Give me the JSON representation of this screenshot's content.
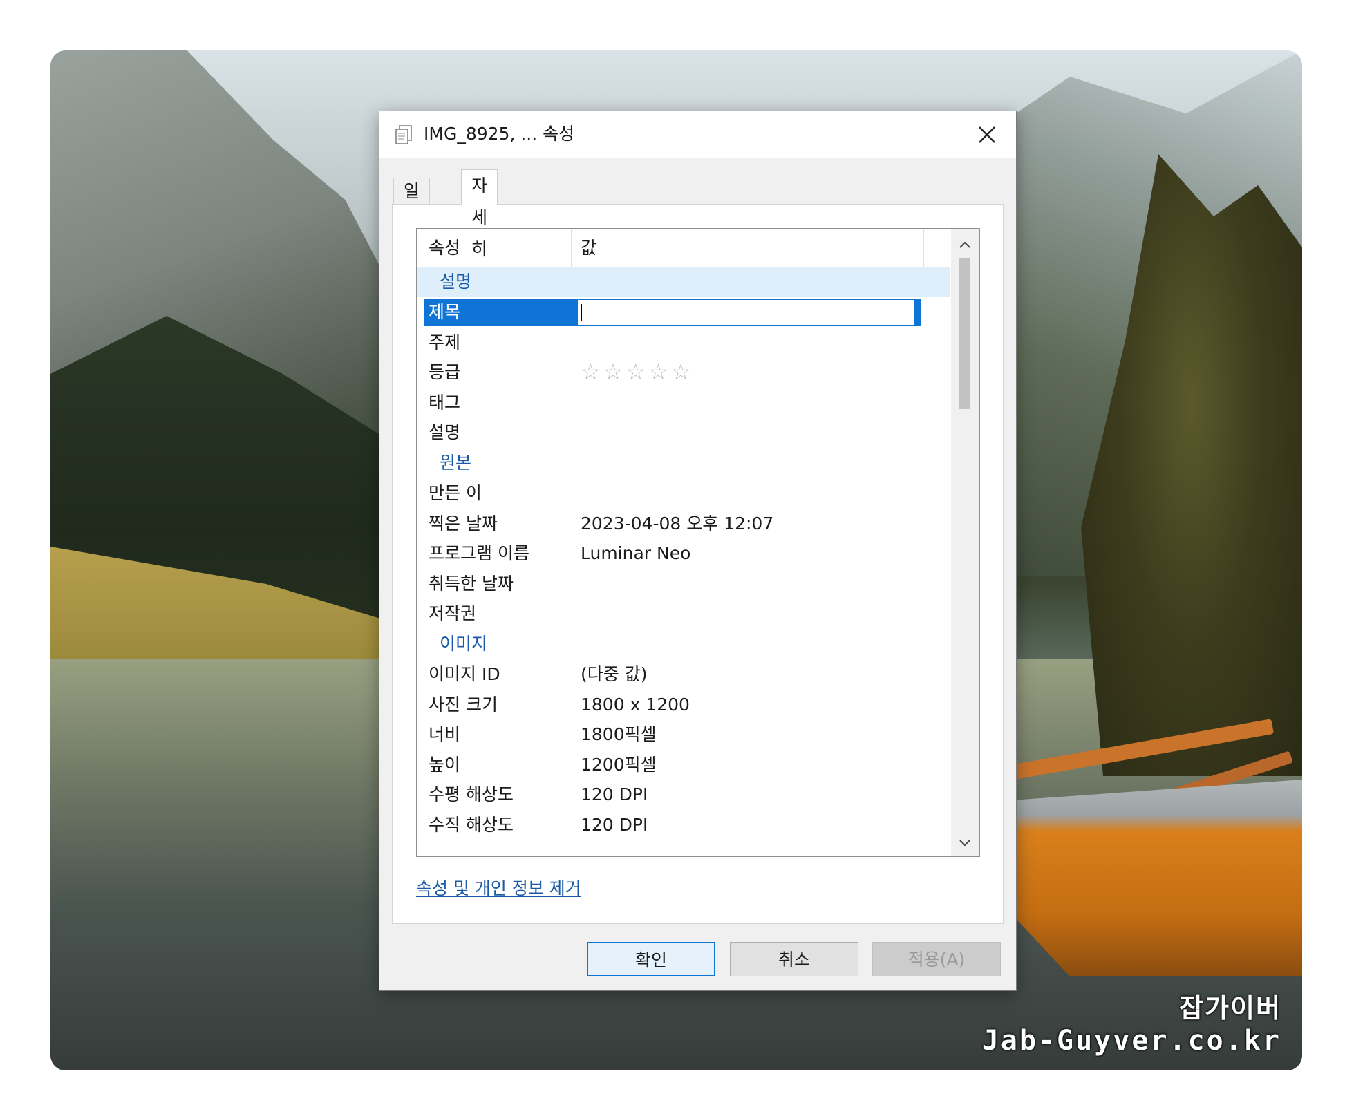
{
  "window": {
    "title": "IMG_8925, ... 속성"
  },
  "tabs": [
    {
      "label": "일반",
      "active": false
    },
    {
      "label": "자세히",
      "active": true
    }
  ],
  "columns": {
    "name": "속성",
    "value": "값"
  },
  "groups": {
    "description": {
      "label": "설명",
      "rows": [
        {
          "name": "제목",
          "value": "",
          "selected": true
        },
        {
          "name": "주제",
          "value": ""
        },
        {
          "name": "등급",
          "value": "☆☆☆☆☆",
          "rating_stars": 0,
          "rating_max": 5
        },
        {
          "name": "태그",
          "value": ""
        },
        {
          "name": "설명",
          "value": ""
        }
      ]
    },
    "origin": {
      "label": "원본",
      "rows": [
        {
          "name": "만든 이",
          "value": ""
        },
        {
          "name": "찍은 날짜",
          "value": "2023-04-08 오후 12:07"
        },
        {
          "name": "프로그램 이름",
          "value": "Luminar Neo"
        },
        {
          "name": "취득한 날짜",
          "value": ""
        },
        {
          "name": "저작권",
          "value": ""
        }
      ]
    },
    "image": {
      "label": "이미지",
      "rows": [
        {
          "name": "이미지 ID",
          "value": "(다중 값)"
        },
        {
          "name": "사진 크기",
          "value": "1800 x 1200"
        },
        {
          "name": "너비",
          "value": "1800픽셀"
        },
        {
          "name": "높이",
          "value": "1200픽셀"
        },
        {
          "name": "수평 해상도",
          "value": "120 DPI"
        },
        {
          "name": "수직 해상도",
          "value": "120 DPI"
        }
      ]
    }
  },
  "links": {
    "remove_properties": "속성 및 개인 정보 제거"
  },
  "buttons": {
    "ok": "확인",
    "cancel": "취소",
    "apply": "적용(A)"
  },
  "icons": {
    "close": "close-icon",
    "scroll_up": "chevron-up-icon",
    "scroll_down": "chevron-down-icon",
    "title": "document-copy-icon"
  },
  "watermark": {
    "line1": "잡가이버",
    "line2": "Jab-Guyver.co.kr"
  },
  "colors": {
    "accent": "#0e74d6",
    "group_label": "#1a5aa8",
    "group_highlight": "#dfeefb"
  }
}
